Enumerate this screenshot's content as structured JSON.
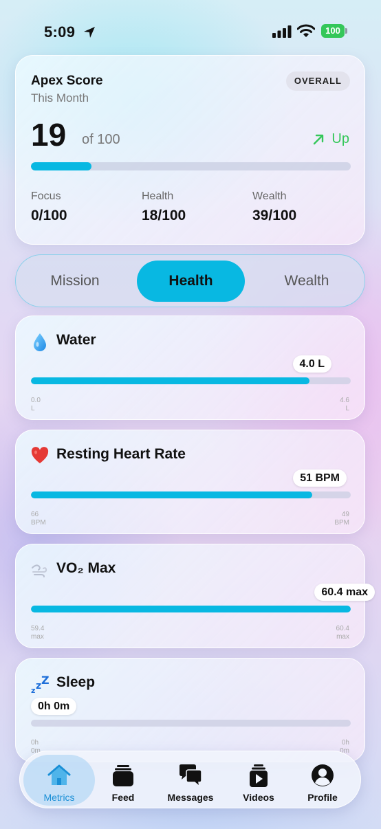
{
  "status": {
    "time": "5:09",
    "battery": "100"
  },
  "apex": {
    "title": "Apex Score",
    "subtitle": "This Month",
    "badge": "OVERALL",
    "score": "19",
    "of": "of 100",
    "score_fraction": 0.19,
    "trend": "Up",
    "breakdown": [
      {
        "label": "Focus",
        "value": "0/100"
      },
      {
        "label": "Health",
        "value": "18/100"
      },
      {
        "label": "Wealth",
        "value": "39/100"
      }
    ]
  },
  "segments": [
    {
      "label": "Mission",
      "active": false
    },
    {
      "label": "Health",
      "active": true
    },
    {
      "label": "Wealth",
      "active": false
    }
  ],
  "metrics": [
    {
      "name": "Water",
      "icon": "water-drop-icon",
      "value": "4.0 L",
      "fill": 0.87,
      "min_value": "0.0",
      "min_unit": "L",
      "max_value": "4.6",
      "max_unit": "L"
    },
    {
      "name": "Resting Heart Rate",
      "icon": "heart-icon",
      "value": "51 BPM",
      "fill": 0.88,
      "min_value": "66",
      "min_unit": "BPM",
      "max_value": "49",
      "max_unit": "BPM"
    },
    {
      "name": "VO₂ Max",
      "icon": "wind-icon",
      "value": "60.4 max",
      "fill": 1.0,
      "min_value": "59.4",
      "min_unit": "max",
      "max_value": "60.4",
      "max_unit": "max"
    },
    {
      "name": "Sleep",
      "icon": "zzz-icon",
      "value": "0h 0m",
      "fill": 0.0,
      "min_value": "0h",
      "min_unit": "0m",
      "max_value": "0h",
      "max_unit": "0m"
    }
  ],
  "nav": [
    {
      "label": "Metrics",
      "icon": "home-icon",
      "active": true
    },
    {
      "label": "Feed",
      "icon": "stack-icon",
      "active": false
    },
    {
      "label": "Messages",
      "icon": "chat-bubbles-icon",
      "active": false
    },
    {
      "label": "Videos",
      "icon": "video-play-icon",
      "active": false
    },
    {
      "label": "Profile",
      "icon": "person-icon",
      "active": false
    }
  ],
  "colors": {
    "accent": "#08b8e2",
    "trend_up": "#34c759",
    "nav_active": "#1a8fd6"
  }
}
